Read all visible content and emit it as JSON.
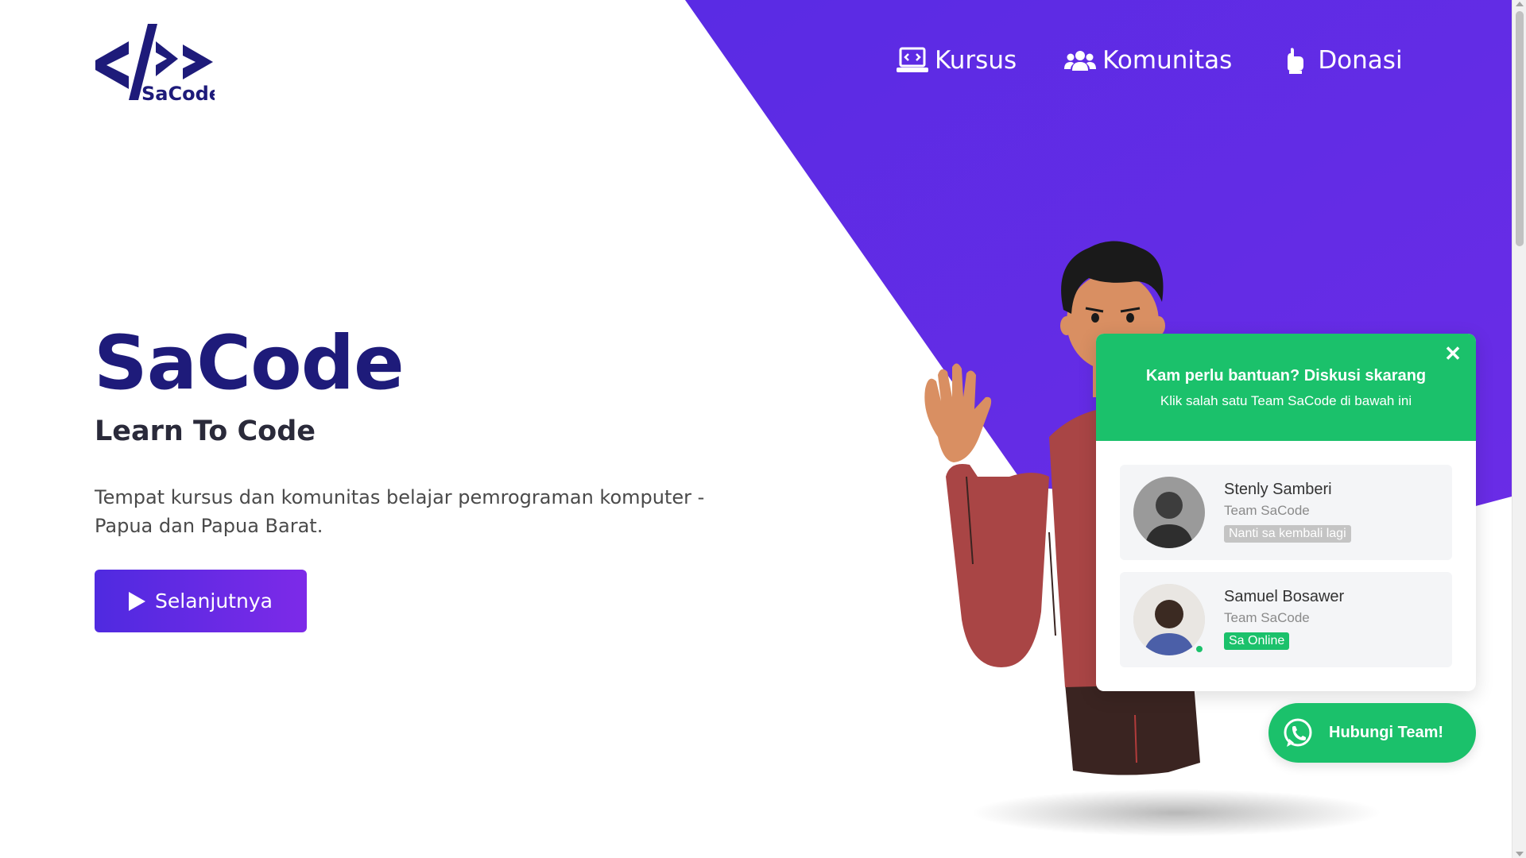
{
  "brand": {
    "logo_text": "SaCode",
    "colors": {
      "purple": "#5b2be0",
      "navy": "#1e1b7a",
      "green": "#1bc16b"
    }
  },
  "nav": {
    "items": [
      {
        "label": "Kursus",
        "icon": "laptop-code-icon"
      },
      {
        "label": "Komunitas",
        "icon": "users-icon"
      },
      {
        "label": "Donasi",
        "icon": "donate-hand-icon"
      }
    ]
  },
  "hero": {
    "title": "SaCode",
    "subtitle": "Learn To Code",
    "description": "Tempat kursus dan komunitas belajar pemrograman komputer - Papua dan Papua Barat.",
    "cta_label": "Selanjutnya",
    "cta_icon": "play-icon"
  },
  "chat": {
    "title": "Kam perlu bantuan? Diskusi skarang",
    "subtitle": "Klik salah satu Team SaCode di bawah ini",
    "close_icon": "close-icon",
    "agents": [
      {
        "name": "Stenly Samberi",
        "role": "Team SaCode",
        "status": "Nanti sa kembali lagi",
        "online": false
      },
      {
        "name": "Samuel Bosawer",
        "role": "Team SaCode",
        "status": "Sa Online",
        "online": true
      }
    ]
  },
  "whatsapp": {
    "label": "Hubungi Team!",
    "icon": "whatsapp-icon"
  }
}
